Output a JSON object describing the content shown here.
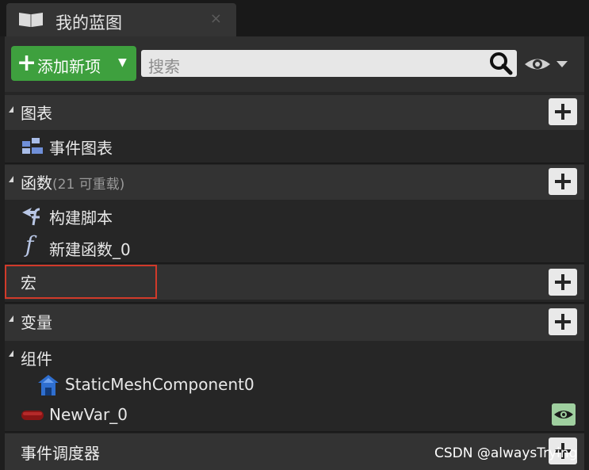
{
  "tab": {
    "title": "我的蓝图",
    "close_glyph": "×",
    "icon": "book-icon"
  },
  "toolbar": {
    "add_label": "添加新项",
    "search_placeholder": "搜索"
  },
  "sections": {
    "graphs": {
      "title": "图表",
      "items": [
        {
          "label": "事件图表",
          "icon": "event-graph-icon"
        }
      ]
    },
    "functions": {
      "title": "函数",
      "count": "(21 可重载)",
      "items": [
        {
          "label": "构建脚本",
          "icon": "construction-script-icon"
        },
        {
          "label": "新建函数_0",
          "icon": "function-icon"
        }
      ]
    },
    "macros": {
      "title": "宏"
    },
    "variables": {
      "title": "变量",
      "subgroup": "组件",
      "items": [
        {
          "label": "StaticMeshComponent0",
          "icon": "component-icon"
        },
        {
          "label": "NewVar_0",
          "icon": "variable-pill-icon"
        }
      ]
    },
    "dispatchers": {
      "title": "事件调度器"
    }
  },
  "colors": {
    "accent_green": "#3ea03e",
    "selection_red": "#d13a2a",
    "visible_eye": "#9fcf9f"
  },
  "watermark": "CSDN @alwaysTrying"
}
